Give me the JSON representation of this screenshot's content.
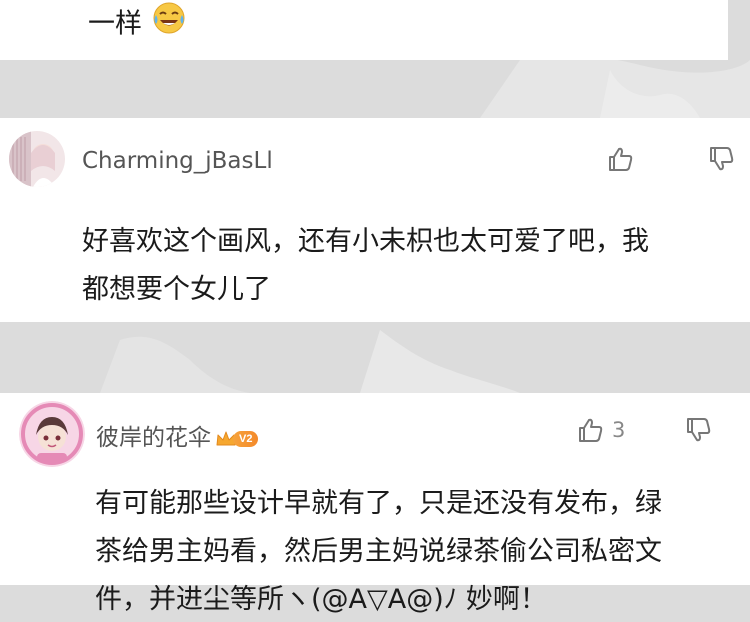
{
  "feed": {
    "top_comment": {
      "text": "一样",
      "emoji": "tears-of-joy-emoji"
    },
    "comments": [
      {
        "username": "Charming_jBasLl",
        "lines": [
          "好喜欢这个画风，还有小未枳也太可爱了吧，我",
          "都想要个女儿了"
        ],
        "like_count": "",
        "has_badge": false
      },
      {
        "username": "彼岸的花伞",
        "badge_level": "V2",
        "lines": [
          "有可能那些设计早就有了，只是还没有发布，绿",
          "茶给男主妈看，然后男主妈说绿茶偷公司私密文",
          "件，并进尘等所ヽ(@A▽A@)ﾉ 妙啊！"
        ],
        "like_count": "3",
        "has_badge": true
      }
    ]
  },
  "icons": {
    "like": "thumbs-up-icon",
    "dislike": "thumbs-down-icon",
    "badge": "crown-icon"
  }
}
